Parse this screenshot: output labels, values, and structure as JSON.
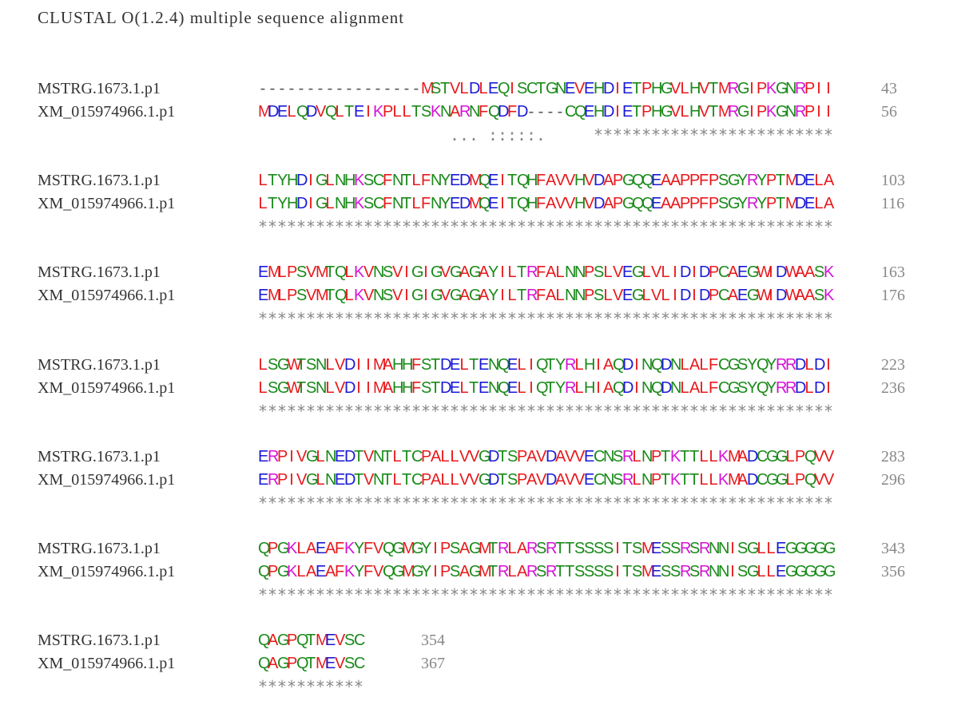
{
  "header": "CLUSTAL O(1.2.4) multiple sequence alignment",
  "colors": {
    "hydrophobic": "#e8191c",
    "acidic": "#1a1ad6",
    "basic": "#d612d6",
    "polar": "#1a8a1a",
    "other": "#555555"
  },
  "blocks": [
    {
      "rows": [
        {
          "name": "MSTRG.1673.1.p1",
          "seq": "-----------------MSTVLDLEQISCTGNEVEHDIETPHGVLHVTMRGIPKGNRPII",
          "count": "43"
        },
        {
          "name": "XM_015974966.1.p1",
          "seq": "MDELQDVQLTEIKPLLTSKNARNFQDFD----CQEHDIETPHGVLHVTMRGIPKGNRPII",
          "count": "56"
        }
      ],
      "consensus": "                    ... :::::.     *************************"
    },
    {
      "rows": [
        {
          "name": "MSTRG.1673.1.p1",
          "seq": "LTYHDIGLNHKSCFNTLFNYEDMQEITQHFAVVHVDAPGQQEAAPPFPSGYRYPTMDELA",
          "count": "103"
        },
        {
          "name": "XM_015974966.1.p1",
          "seq": "LTYHDIGLNHKSCFNTLFNYEDMQEITQHFAVVHVDAPGQQEAAPPFPSGYRYPTMDELA",
          "count": "116"
        }
      ],
      "consensus": "************************************************************"
    },
    {
      "rows": [
        {
          "name": "MSTRG.1673.1.p1",
          "seq": "EMLPSVMTQLKVNSVIGIGVGAGAYILTRFALNNPSLVEGLVLIDIDPCAEGWIDWAASK",
          "count": "163"
        },
        {
          "name": "XM_015974966.1.p1",
          "seq": "EMLPSVMTQLKVNSVIGIGVGAGAYILTRFALNNPSLVEGLVLIDIDPCAEGWIDWAASK",
          "count": "176"
        }
      ],
      "consensus": "************************************************************"
    },
    {
      "rows": [
        {
          "name": "MSTRG.1673.1.p1",
          "seq": "LSGWTSNLVDIIMAHHFSTDELTENQELIQTYRLHIAQDINQDNLALFCGSYQYRRDLDI",
          "count": "223"
        },
        {
          "name": "XM_015974966.1.p1",
          "seq": "LSGWTSNLVDIIMAHHFSTDELTENQELIQTYRLHIAQDINQDNLALFCGSYQYRRDLDI",
          "count": "236"
        }
      ],
      "consensus": "************************************************************"
    },
    {
      "rows": [
        {
          "name": "MSTRG.1673.1.p1",
          "seq": "ERPIVGLNEDTVNTLTCPALLVVGDTSPAVDAVVECNSRLNPTKTTLLKMADCGGLPQVV",
          "count": "283"
        },
        {
          "name": "XM_015974966.1.p1",
          "seq": "ERPIVGLNEDTVNTLTCPALLVVGDTSPAVDAVVECNSRLNPTKTTLLKMADCGGLPQVV",
          "count": "296"
        }
      ],
      "consensus": "************************************************************"
    },
    {
      "rows": [
        {
          "name": "MSTRG.1673.1.p1",
          "seq": "QPGKLAEAFKYFVQGMGYIPSAGMTRLARSRTTSSSSITSMESSRSRNNISGLLEGGGGG",
          "count": "343"
        },
        {
          "name": "XM_015974966.1.p1",
          "seq": "QPGKLAEAFKYFVQGMGYIPSAGMTRLARSRTTSSSSITSMESSRSRNNISGLLEGGGGG",
          "count": "356"
        }
      ],
      "consensus": "************************************************************"
    },
    {
      "rows": [
        {
          "name": "MSTRG.1673.1.p1",
          "seq": "QAGPQTMEVSC",
          "count": "354"
        },
        {
          "name": "XM_015974966.1.p1",
          "seq": "QAGPQTMEVSC",
          "count": "367"
        }
      ],
      "consensus": "***********"
    }
  ]
}
